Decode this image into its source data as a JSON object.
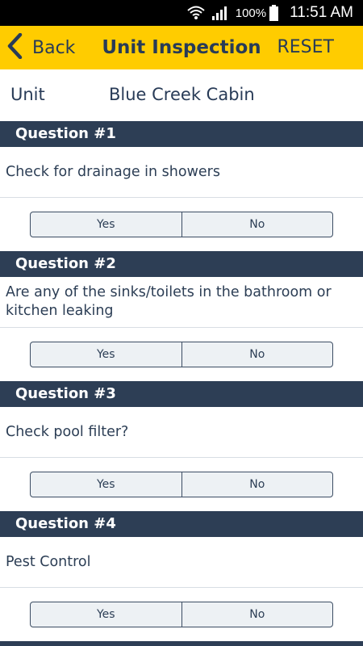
{
  "status_bar": {
    "battery": "100%",
    "time": "11:51 AM",
    "icons": [
      "wifi-icon",
      "signal-icon",
      "battery-icon"
    ]
  },
  "app_bar": {
    "back_label": "Back",
    "title": "Unit Inspection",
    "reset_label": "RESET",
    "background_color": "#FFCC00",
    "text_color": "#283B57"
  },
  "unit": {
    "label": "Unit",
    "value": "Blue Creek Cabin"
  },
  "questions": [
    {
      "header": "Question #1",
      "text": "Check for drainage in showers",
      "yes_label": "Yes",
      "no_label": "No"
    },
    {
      "header": "Question #2",
      "text": "Are any of the sinks/toilets  in the bathroom or kitchen leaking",
      "yes_label": "Yes",
      "no_label": "No"
    },
    {
      "header": "Question #3",
      "text": "Check pool filter?",
      "yes_label": "Yes",
      "no_label": "No"
    },
    {
      "header": "Question #4",
      "text": "Pest Control",
      "yes_label": "Yes",
      "no_label": "No"
    }
  ],
  "colors": {
    "header_bar": "#2D3E55",
    "toggle_background": "#EDF1F4"
  }
}
